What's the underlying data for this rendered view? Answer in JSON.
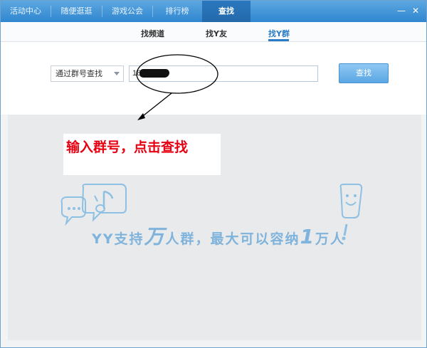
{
  "nav": {
    "items": [
      "活动中心",
      "随便逛逛",
      "游戏公会",
      "排行榜",
      "查找"
    ],
    "active_index": 4,
    "minimize": "—",
    "close": "✕"
  },
  "subtabs": {
    "items": [
      "找频道",
      "找Y友",
      "找Y群"
    ],
    "active_index": 2
  },
  "search": {
    "select_value": "通过群号查找",
    "input_value": "18",
    "button_label": "查找"
  },
  "callout": {
    "text": "输入群号，点击查找"
  },
  "banner": {
    "slogan_part1": "YY支持",
    "slogan_big1": "万",
    "slogan_part2": "人群，最大可以容纳",
    "slogan_big2": "1",
    "slogan_part3": "万人"
  },
  "colors": {
    "nav_bg": "#3b93d8",
    "accent": "#2a7cc7",
    "callout_text": "#e60012",
    "content_bg": "#e9eaec"
  }
}
